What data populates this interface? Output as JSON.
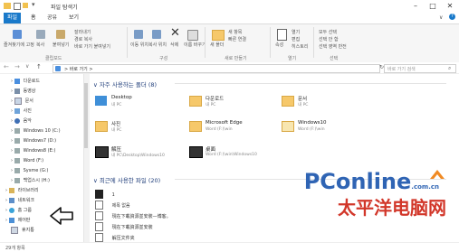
{
  "window": {
    "title": "파일 탐색기"
  },
  "tabs": [
    "파일",
    "홈",
    "공유",
    "보기"
  ],
  "ribbon": {
    "labels": [
      "즐겨찾기에 고정",
      "복사",
      "붙여넣기",
      "잘라내기",
      "경로 복사",
      "바로 가기 붙여넣기",
      "이동 위치",
      "복사 위치",
      "삭제",
      "이름 바꾸기",
      "새 폴더",
      "새 항목",
      "빠른 연결",
      "속성",
      "열기",
      "편집",
      "히스토리",
      "모두 선택",
      "선택 안 함",
      "선택 영역 반전"
    ],
    "groups": [
      "클립보드",
      "구성",
      "새로 만들기",
      "열기",
      "선택"
    ]
  },
  "address": {
    "path": "> 바로 가기 >",
    "search_placeholder": "바로 가기 검색"
  },
  "nav": [
    "다운로드",
    "동영상",
    "문서",
    "사진",
    "음악",
    "Windows 10 (C:)",
    "Windows7 (D:)",
    "Windows8 (E:)",
    "Word (F:)",
    "Sysme (G:)",
    "백업스시 (H:)",
    "라이브러리",
    "네트워크",
    "홈 그룹",
    "제어판",
    "휴지통"
  ],
  "frequent": {
    "header": "자주 사용하는 폴더 (8)",
    "items": [
      {
        "name": "Desktop",
        "sub": "내 PC"
      },
      {
        "name": "다운로드",
        "sub": "내 PC"
      },
      {
        "name": "문서",
        "sub": "내 PC"
      },
      {
        "name": "사진",
        "sub": "내 PC"
      },
      {
        "name": "Microsoft Edge",
        "sub": "Word (F:)\\win"
      },
      {
        "name": "Windows10",
        "sub": "Word (F:)\\win"
      },
      {
        "name": "解压",
        "sub": "내 PC\\Desktop\\Windows10"
      },
      {
        "name": "桌面",
        "sub": "Word (F:)\\win\\Windows10"
      }
    ]
  },
  "recent": {
    "header": "최근에 사용한 파일 (20)",
    "items": [
      "1",
      "제목 없음",
      "現在下載資源並安裝—博客。",
      "現在下載資源並安裝",
      "解压文件夹"
    ]
  },
  "status": {
    "count": "29개 항목"
  },
  "watermark": {
    "brand_a": "PC",
    "brand_b": "online",
    "domain": ".com.cn",
    "cn": "太平洋电脑网"
  }
}
